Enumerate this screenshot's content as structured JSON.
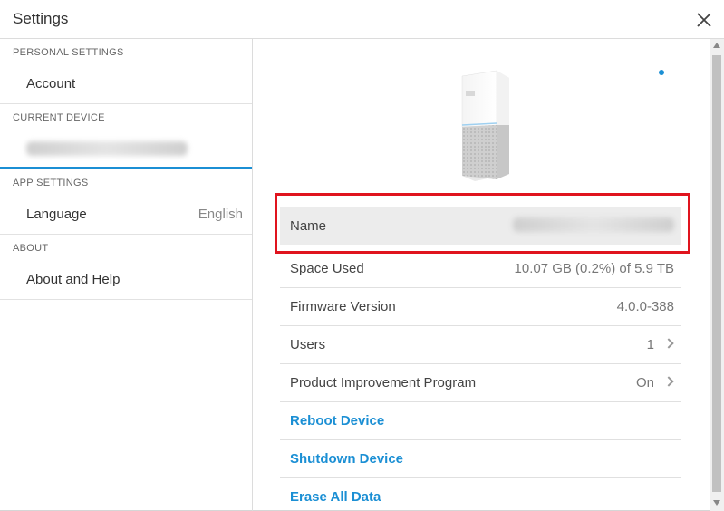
{
  "window": {
    "title": "Settings"
  },
  "sidebar": {
    "sections": [
      {
        "header": "PERSONAL SETTINGS",
        "items": [
          {
            "label": "Account",
            "value": ""
          }
        ]
      },
      {
        "header": "CURRENT DEVICE",
        "items": [
          {
            "label": "",
            "value": ""
          }
        ]
      },
      {
        "header": "APP SETTINGS",
        "items": [
          {
            "label": "Language",
            "value": "English"
          }
        ]
      },
      {
        "header": "ABOUT",
        "items": [
          {
            "label": "About and Help",
            "value": ""
          }
        ]
      }
    ]
  },
  "device": {
    "rows": [
      {
        "label": "Name",
        "value": ""
      },
      {
        "label": "Space Used",
        "value": "10.07 GB (0.2%) of 5.9 TB"
      },
      {
        "label": "Firmware Version",
        "value": "4.0.0-388"
      },
      {
        "label": "Users",
        "value": "1"
      },
      {
        "label": "Product Improvement Program",
        "value": "On"
      }
    ],
    "actions": [
      {
        "label": "Reboot Device"
      },
      {
        "label": "Shutdown Device"
      },
      {
        "label": "Erase All Data"
      }
    ]
  },
  "colors": {
    "accent": "#1b8fd4",
    "highlight": "#e0141e"
  },
  "icons": {
    "close": "close-icon",
    "chevron": "chevron-right-icon"
  }
}
